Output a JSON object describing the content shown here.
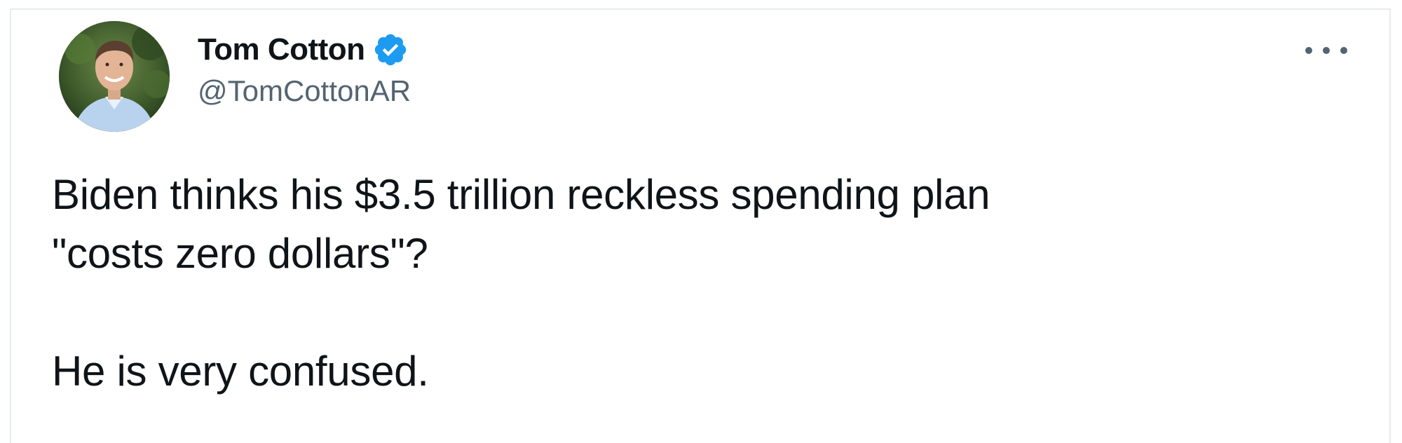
{
  "tweet": {
    "author": {
      "display_name": "Tom Cotton",
      "handle": "@TomCottonAR",
      "verified_icon": "verified-check-icon",
      "avatar_icon": "profile-photo"
    },
    "more_icon": "more-options-icon",
    "text": {
      "line_1": "Biden thinks his $3.5 trillion reckless spending plan",
      "line_2": "\"costs zero dollars\"?",
      "paragraph_2": "He is very confused."
    },
    "colors": {
      "verified": "#1d9bf0",
      "text": "#0f1419",
      "secondary": "#536471",
      "border": "#e6ecf0"
    }
  }
}
